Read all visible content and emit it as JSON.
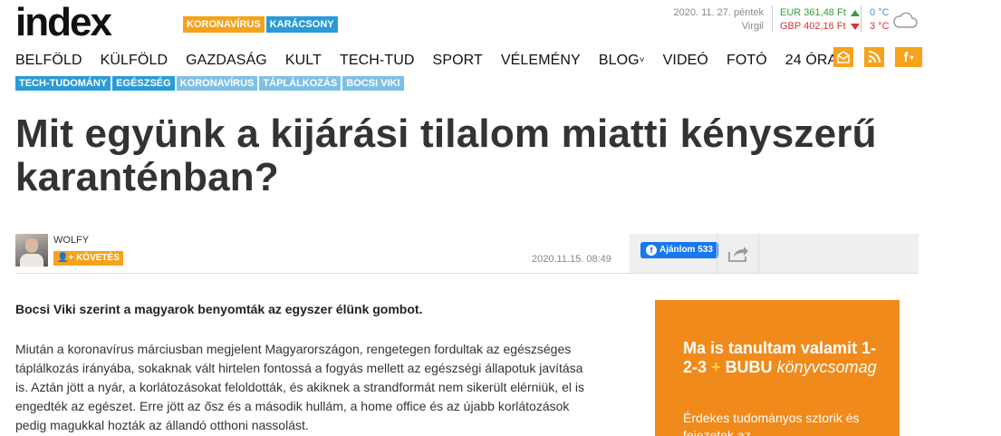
{
  "brand": {
    "logo": "index"
  },
  "hot_tags": [
    "KORONAVÍRUS",
    "KARÁCSONY"
  ],
  "date": {
    "line1": "2020. 11. 27. péntek",
    "line2": "Virgil"
  },
  "fx": [
    {
      "label": "EUR 361,48 Ft",
      "trend": "up",
      "color": "#3a9a3a"
    },
    {
      "label": "GBP 402,16 Ft",
      "trend": "down",
      "color": "#d33333"
    }
  ],
  "weather": {
    "line1": "0 °C",
    "line2": "3 °C",
    "icon": "cloud-icon"
  },
  "nav": {
    "items": [
      "BELFÖLD",
      "KÜLFÖLD",
      "GAZDASÁG",
      "KULT",
      "TECH-TUD",
      "SPORT",
      "VÉLEMÉNY",
      "BLOG",
      "VIDEÓ",
      "FOTÓ",
      "24 ÓRA"
    ],
    "blog_chevron": "˅",
    "icons": [
      "mail-icon",
      "rss-icon",
      "facebook-icon"
    ]
  },
  "subtags": [
    "TECH-TUDOMÁNY",
    "EGÉSZSÉG",
    "KORONAVÍRUS",
    "TÁPLÁLKOZÁS",
    "BOCSI VIKI"
  ],
  "article": {
    "title": "Mit együnk a kijárási tilalom miatti kényszerű karanténban?",
    "author": "WOLFY",
    "follow_label": "KÖVETÉS",
    "date": "2020.11.15. 08:49",
    "lead": "Bocsi Viki szerint a magyarok benyomták az egyszer élünk gombot.",
    "body": "Miután a koronavírus márciusban megjelent Magyarországon, rengetegen fordultak az egészséges táplálkozás irányába, sokaknak vált hirtelen fontossá a fogyás mellett az egészségi állapotuk javítása is. Aztán jött a nyár, a korlátozásokat feloldották, és akiknek a strandformát nem sikerült elérniük, el is engedték az egészet. Erre jött az ősz és a második hullám, a home office és az újabb korlátozások pedig magukkal hozták az állandó otthoni nassolást."
  },
  "share": {
    "fb_label": "Ajánlom 533"
  },
  "ad": {
    "title_a": "Ma is tanultam valamit 1-2-3",
    "plus": "+",
    "title_b": "BUBU",
    "title_c": "könyvcsomag",
    "sub": "Érdekes tudományos sztorik és fejezetek az"
  },
  "colors": {
    "accent": "#f7a21b",
    "blue": "#2a9bd6",
    "ad_bg": "#f08a1b"
  }
}
